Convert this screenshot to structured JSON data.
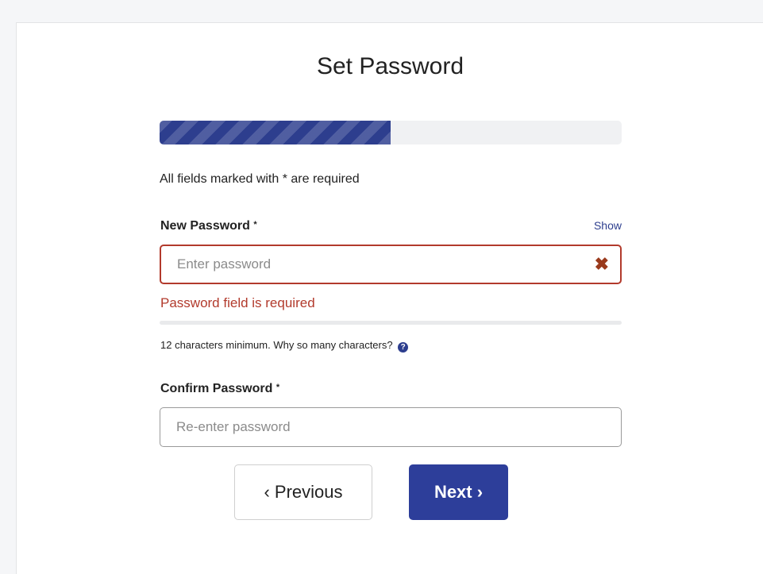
{
  "page": {
    "title": "Set Password"
  },
  "progress": {
    "value_fraction": 0.5,
    "color": "#2d3e8e"
  },
  "form": {
    "required_note": "All fields marked with * are required",
    "new_password": {
      "label": "New Password",
      "required_mark": "*",
      "show_label": "Show",
      "placeholder": "Enter password",
      "value": "",
      "error_icon": "x-mark-icon",
      "error_message": "Password field is required",
      "hint": "12 characters minimum. Why so many characters?",
      "help_icon": "question-circle-icon",
      "help_glyph": "?"
    },
    "confirm_password": {
      "label": "Confirm Password",
      "required_mark": "*",
      "placeholder": "Re-enter password",
      "value": ""
    }
  },
  "buttons": {
    "previous": "‹ Previous",
    "next": "Next ›"
  },
  "colors": {
    "accent": "#2d3e9a",
    "error": "#b23a2c"
  }
}
